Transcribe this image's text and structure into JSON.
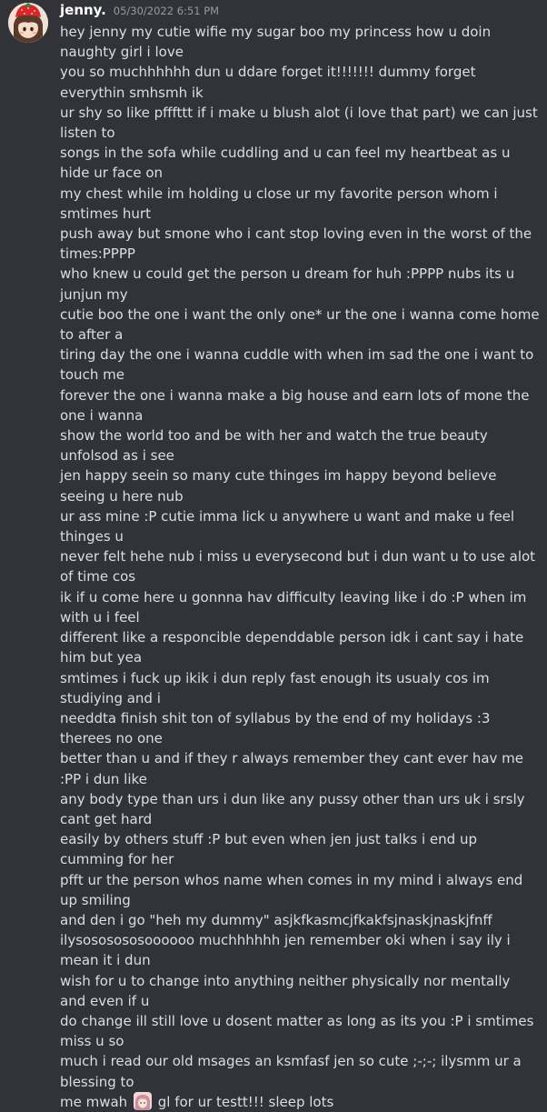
{
  "message": {
    "username": "jenny.",
    "timestamp": "05/30/2022 6:51 PM",
    "avatar_icon": "strawberry-hat-anime-avatar",
    "lines": [
      "hey jenny my cutie wifie my sugar boo my princess how u doin naughty girl i love",
      "you so muchhhhhh dun u ddare forget it!!!!!!! dummy forget everythin smhsmh ik",
      "ur shy so like pfffttt if i make u blush alot (i love that part) we can just listen to",
      "songs in the sofa while cuddling and u can feel my heartbeat as u hide ur face on",
      "my chest while im holding u close ur my favorite person whom i smtimes hurt",
      "push away but smone who i cant stop loving even in the worst of the times:PPPP",
      "who knew u could get the person u dream for huh :PPPP nubs its u junjun my",
      "cutie boo the one i want the only one* ur the one i wanna come home to after a",
      "tiring day the one i wanna cuddle with when im sad the one i want to touch me",
      "forever the one i wanna make a big house and earn lots of mone the one i wanna",
      "show the world too and be with her and watch the true beauty unfolsod as i see",
      "jen happy seein so many cute thinges im happy beyond believe seeing u here nub",
      "ur ass mine :P cutie imma lick u anywhere u want and make u feel thinges u",
      "never felt hehe nub i miss u everysecond but i dun want u to use alot of time cos",
      "ik if u come here u gonnna hav difficulty leaving like i do :P when im with u i feel",
      "different like a responcible dependdable person idk i cant say i hate him but yea",
      "smtimes i fuck up ikik i dun reply fast enough its usualy cos im studiying and i",
      "needdta finish shit ton of syllabus by the end of my holidays :3 therees no one",
      "better than u and if they r always remember they cant ever hav me :PP i dun like",
      "any body type than urs i dun like any pussy other than urs uk i srsly cant get hard",
      "easily by others stuff :P but even when jen just talks i end up cumming for her",
      "pfft ur the person whos name when comes in my mind i always end up smiling",
      "and den i go \"heh my dummy\" asjkfkasmcjfkakfsjnaskjnaskjfnff",
      "ilysososososoooooo muchhhhhh jen remember oki when i say ily i mean it i dun",
      "wish for u to change into anything neither physically nor mentally and even if u",
      "do change ill still love u dosent matter as long as its you :P i smtimes miss u so",
      "much i read our old msages an ksmfasf jen so cute ;-;-; ilysmm ur a blessing to"
    ],
    "last_line_before_emoji": "me mwah ",
    "emoji_name": "anime-girl-emoji",
    "last_line_after_emoji": " gl for ur testt!!! sleep lots"
  }
}
